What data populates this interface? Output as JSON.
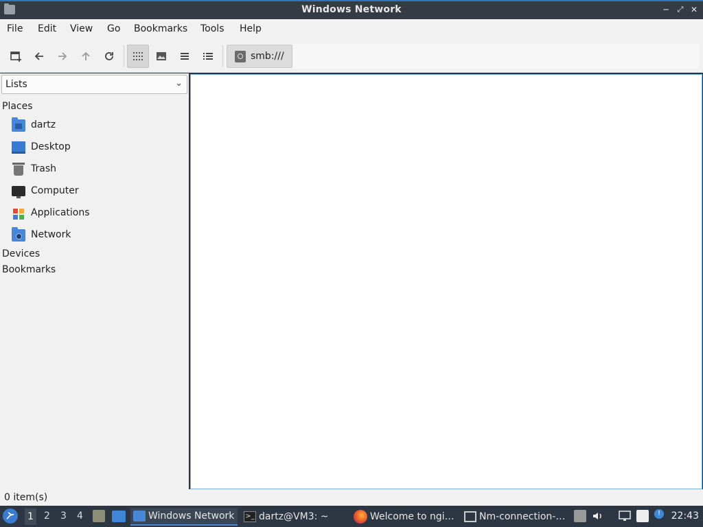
{
  "window": {
    "title": "Windows Network"
  },
  "menu": [
    "File",
    "Edit",
    "View",
    "Go",
    "Bookmarks",
    "Tools",
    "Help"
  ],
  "toolbar": {
    "icons": [
      "new-tab-icon",
      "back-arrow-icon",
      "forward-arrow-icon",
      "up-arrow-icon",
      "reload-icon",
      "icon-view-icon",
      "thumbnail-view-icon",
      "compact-view-icon",
      "detailed-list-icon"
    ],
    "path_button": "smb:///"
  },
  "sidebar": {
    "mode": "Lists",
    "places_header": "Places",
    "places": [
      {
        "label": "dartz",
        "icon": "home-folder-icon"
      },
      {
        "label": "Desktop",
        "icon": "desktop-icon"
      },
      {
        "label": "Trash",
        "icon": "trash-icon"
      },
      {
        "label": "Computer",
        "icon": "computer-icon"
      },
      {
        "label": "Applications",
        "icon": "applications-icon"
      },
      {
        "label": "Network",
        "icon": "network-folder-icon"
      }
    ],
    "devices_header": "Devices",
    "bookmarks_header": "Bookmarks"
  },
  "status": {
    "text": "0 item(s)"
  },
  "taskbar": {
    "workspaces": [
      "1",
      "2",
      "3",
      "4"
    ],
    "current_workspace": "1",
    "tasks": [
      {
        "label": "Windows Network",
        "icon": "folder-icon",
        "active": true
      },
      {
        "label": "dartz@VM3: ~",
        "icon": "terminal-icon",
        "active": false
      },
      {
        "label": "Welcome to ngi…",
        "icon": "firefox-icon",
        "active": false
      },
      {
        "label": "Nm-connection-…",
        "icon": "network-connection-icon",
        "active": false
      }
    ],
    "clock": "22:43"
  },
  "colors": {
    "accent": "#4a86d8",
    "titlebar": "#343b45",
    "taskbar": "#2d3743"
  }
}
